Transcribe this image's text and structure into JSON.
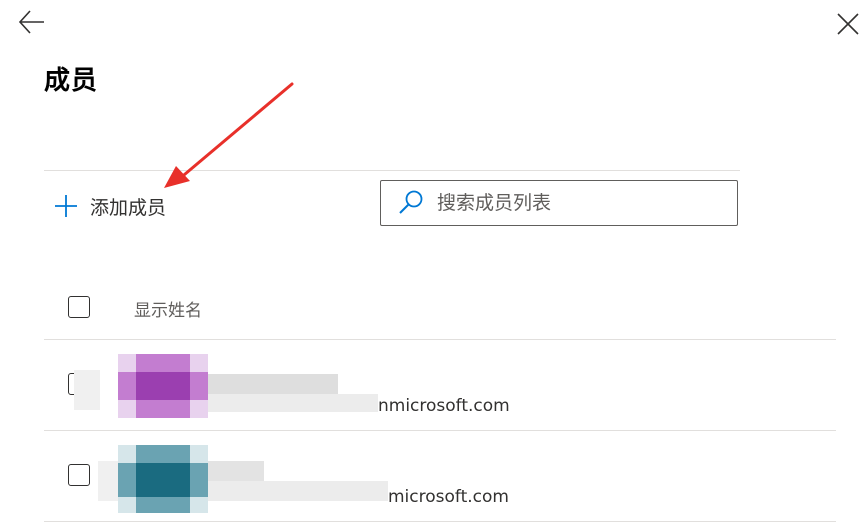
{
  "page": {
    "title": "成员"
  },
  "toolbar": {
    "add_label": "添加成员",
    "search_placeholder": "搜索成员列表"
  },
  "table": {
    "header_display_name": "显示姓名",
    "rows": [
      {
        "email_visible": "nmicrosoft.com",
        "avatar_color": "#9b3fb0"
      },
      {
        "email_visible": "microsoft.com",
        "avatar_color": "#1a6b80"
      }
    ]
  },
  "colors": {
    "accent": "#0078d4",
    "annotation_arrow": "#e8302a"
  },
  "icons": {
    "back": "arrow-left-icon",
    "close": "close-icon",
    "add": "plus-icon",
    "search": "search-icon"
  }
}
